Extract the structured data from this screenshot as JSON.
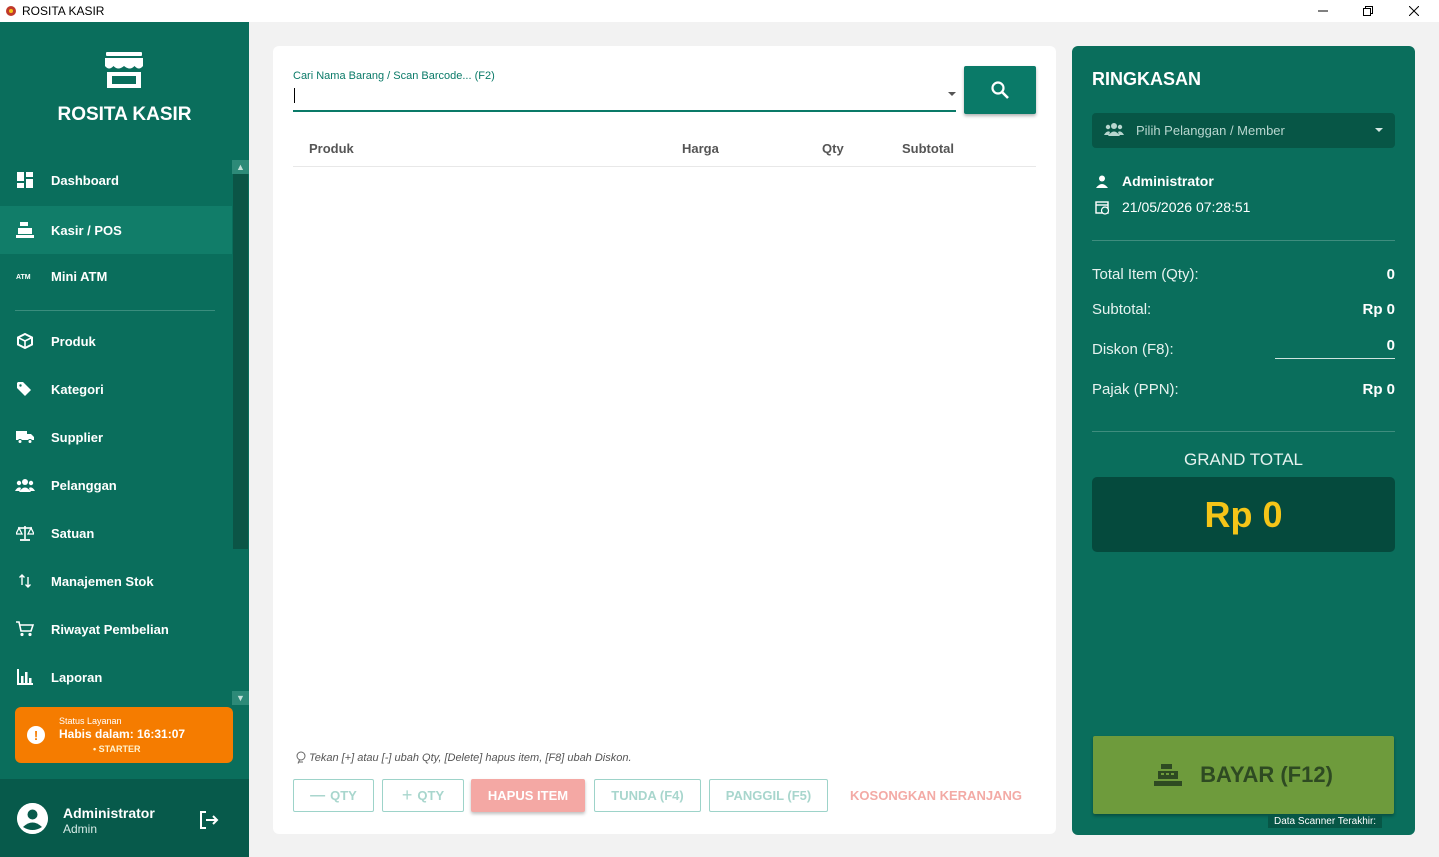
{
  "window": {
    "title": "ROSITA KASIR",
    "controls": [
      "minimize",
      "restore",
      "close"
    ]
  },
  "sidebar": {
    "brand": "ROSITA KASIR",
    "items": [
      {
        "label": "Dashboard",
        "icon": "dashboard-icon"
      },
      {
        "label": "Kasir / POS",
        "icon": "cash-register-icon",
        "active": true
      },
      {
        "label": "Mini ATM",
        "icon": "atm-icon"
      },
      {
        "label": "Produk",
        "icon": "box-icon"
      },
      {
        "label": "Kategori",
        "icon": "tags-icon"
      },
      {
        "label": "Supplier",
        "icon": "truck-icon"
      },
      {
        "label": "Pelanggan",
        "icon": "users-icon"
      },
      {
        "label": "Satuan",
        "icon": "scale-icon"
      },
      {
        "label": "Manajemen Stok",
        "icon": "swap-vertical-icon"
      },
      {
        "label": "Riwayat Pembelian",
        "icon": "cart-icon"
      },
      {
        "label": "Laporan",
        "icon": "bar-chart-icon"
      }
    ],
    "status": {
      "caption": "Status Layanan",
      "expiry": "Habis dalam: 16:31:07",
      "plan": "• STARTER",
      "color": "#f57c00"
    },
    "user": {
      "name": "Administrator",
      "role": "Admin"
    }
  },
  "main": {
    "search": {
      "label": "Cari Nama Barang / Scan Barcode... (F2)",
      "value": ""
    },
    "columns": [
      "Produk",
      "Harga",
      "Qty",
      "Subtotal"
    ],
    "rows": [],
    "hint": "Tekan [+] atau [-] ubah Qty, [Delete] hapus item, [F8] ubah Diskon.",
    "buttons": {
      "qty_minus": "QTY",
      "qty_plus": "QTY",
      "hapus": "HAPUS ITEM",
      "tunda": "TUNDA (F4)",
      "panggil": "PANGGIL (F5)",
      "kosongkan": "KOSONGKAN KERANJANG"
    }
  },
  "summary": {
    "title": "RINGKASAN",
    "member_placeholder": "Pilih Pelanggan / Member",
    "cashier": "Administrator",
    "datetime": "21/05/2026 07:28:51",
    "total_item_label": "Total Item (Qty):",
    "total_item_value": "0",
    "subtotal_label": "Subtotal:",
    "subtotal_value": "Rp 0",
    "diskon_label": "Diskon (F8):",
    "diskon_value": "0",
    "pajak_label": "Pajak (PPN):",
    "pajak_value": "Rp 0",
    "grand_total_label": "GRAND TOTAL",
    "grand_total_value": "Rp 0",
    "pay_label": "BAYAR (F12)",
    "scanner_label": "Data Scanner Terakhir:"
  },
  "colors": {
    "primary": "#0a6e5c",
    "accent": "#f5c518",
    "danger": "#f4a8a4",
    "pay": "#6e9b3c"
  }
}
